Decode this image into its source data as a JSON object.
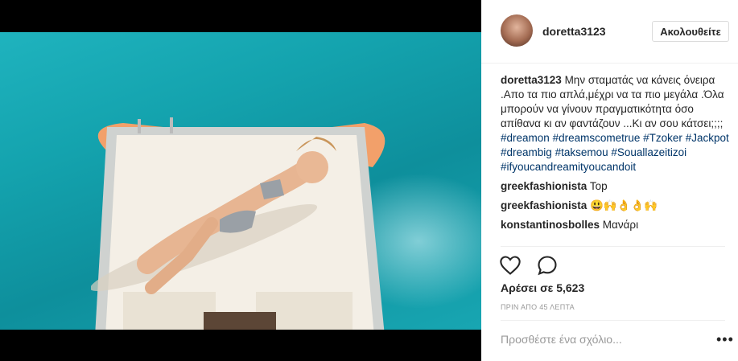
{
  "header": {
    "username": "doretta3123",
    "follow_label": "Ακολουθείτε"
  },
  "caption": {
    "username": "doretta3123",
    "text": "Μην σταματάς να κάνεις όνειρα .Απο τα πιο απλά,μέχρι να τα πιο μεγάλα .Όλα μπορούν να γίνουν πραγματικότητα όσο απίθανα κι αν φαντάζουν ...Κι αν σου κάτσει;;;;",
    "hashtags": [
      "#dreamon",
      "#dreamscometrue",
      "#Tzoker",
      "#Jackpot",
      "#dreambig",
      "#taksemou",
      "#Souallazeitizoi",
      "#ifyoucandreamityoucandoit"
    ]
  },
  "comments": [
    {
      "username": "greekfashionista",
      "text": "Top"
    },
    {
      "username": "greekfashionista",
      "text": "😃🙌👌👌🙌"
    },
    {
      "username": "konstantinosbolles",
      "text": "Μανάρι"
    }
  ],
  "actions": {
    "like_icon": "heart-icon",
    "comment_icon": "comment-bubble-icon"
  },
  "likes_text": "Αρέσει σε 5,623",
  "timestamp": "ΠΡΙΝ ΑΠΟ 45 ΛΕΠΤΑ",
  "add_comment_placeholder": "Προσθέστε ένα σχόλιο...",
  "more_label": "•••"
}
